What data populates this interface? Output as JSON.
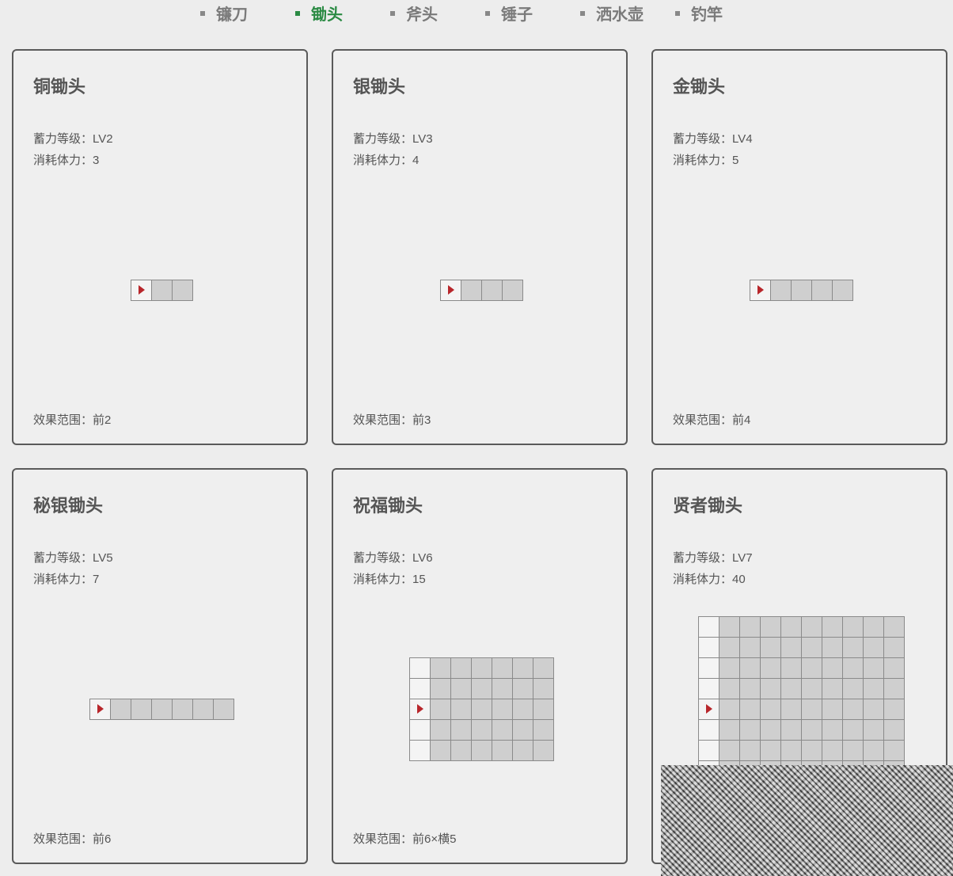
{
  "tabs": [
    {
      "label": "镰刀",
      "active": false
    },
    {
      "label": "锄头",
      "active": true
    },
    {
      "label": "斧头",
      "active": false
    },
    {
      "label": "锤子",
      "active": false
    },
    {
      "label": "洒水壶",
      "active": false
    },
    {
      "label": "钓竿",
      "active": false
    }
  ],
  "colors": {
    "accent": "#2a8a43",
    "arrow": "#b8262b",
    "cell": "#cfcfcf"
  },
  "cards": [
    {
      "title": "铜锄头",
      "level": "蓄力等级：LV2",
      "stamina": "消耗体力：3",
      "range": "效果范围：前2",
      "grid": {
        "forward": 2,
        "width": 1
      }
    },
    {
      "title": "银锄头",
      "level": "蓄力等级：LV3",
      "stamina": "消耗体力：4",
      "range": "效果范围：前3",
      "grid": {
        "forward": 3,
        "width": 1
      }
    },
    {
      "title": "金锄头",
      "level": "蓄力等级：LV4",
      "stamina": "消耗体力：5",
      "range": "效果范围：前4",
      "grid": {
        "forward": 4,
        "width": 1
      }
    },
    {
      "title": "秘银锄头",
      "level": "蓄力等级：LV5",
      "stamina": "消耗体力：7",
      "range": "效果范围：前6",
      "grid": {
        "forward": 6,
        "width": 1
      }
    },
    {
      "title": "祝福锄头",
      "level": "蓄力等级：LV6",
      "stamina": "消耗体力：15",
      "range": "效果范围：前6×横5",
      "grid": {
        "forward": 6,
        "width": 5
      }
    },
    {
      "title": "贤者锄头",
      "level": "蓄力等级：LV7",
      "stamina": "消耗体力：40",
      "range": "",
      "grid": {
        "forward": 9,
        "width": 9
      }
    }
  ]
}
